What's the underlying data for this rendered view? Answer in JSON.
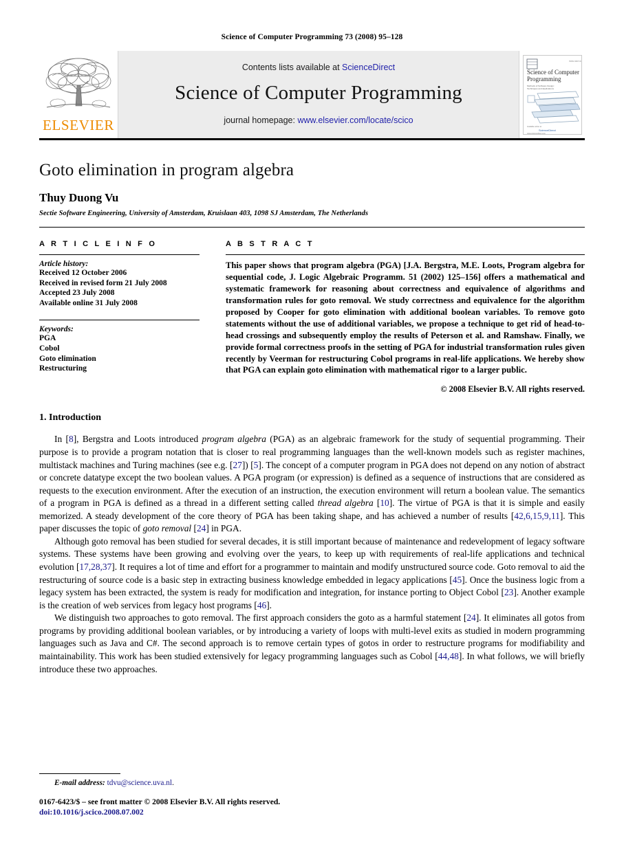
{
  "running_head": "Science of Computer Programming 73 (2008) 95–128",
  "masthead": {
    "publisher_name": "ELSEVIER",
    "publisher_logo_icon": "elsevier-tree-icon",
    "contents_prefix": "Contents lists available at ",
    "contents_link": "ScienceDirect",
    "journal_title": "Science of Computer Programming",
    "homepage_prefix": "journal homepage: ",
    "homepage_link": "www.elsevier.com/locate/scico",
    "cover": {
      "title_line1": "Science of Computer",
      "title_line2": "Programming",
      "subtitle": "Methods of Software Design: Techniques and Applications",
      "corner_label": "ScienceDirect",
      "footer_label": "www.sciencedirect.com"
    }
  },
  "article": {
    "title": "Goto elimination in program algebra",
    "author": "Thuy Duong Vu",
    "affiliation": "Sectie Software Engineering, University of Amsterdam, Kruislaan 403, 1098 SJ Amsterdam, The Netherlands"
  },
  "article_info": {
    "heading": "A R T I C L E   I N F O",
    "history_label": "Article history:",
    "history": [
      "Received 12 October 2006",
      "Received in revised form 21 July 2008",
      "Accepted 23 July 2008",
      "Available online 31 July 2008"
    ],
    "keywords_label": "Keywords:",
    "keywords": [
      "PGA",
      "Cobol",
      "Goto elimination",
      "Restructuring"
    ]
  },
  "abstract": {
    "heading": "A B S T R A C T",
    "text": "This paper shows that program algebra (PGA) [J.A. Bergstra, M.E. Loots, Program algebra for sequential code, J. Logic Algebraic Programm. 51 (2002) 125–156] offers a mathematical and systematic framework for reasoning about correctness and equivalence of algorithms and transformation rules for goto removal. We study correctness and equivalence for the algorithm proposed by Cooper for goto elimination with additional boolean variables. To remove goto statements without the use of additional variables, we propose a technique to get rid of head-to-head crossings and subsequently employ the results of Peterson et al. and Ramshaw. Finally, we provide formal correctness proofs in the setting of PGA for industrial transformation rules given recently by Veerman for restructuring Cobol programs in real-life applications. We hereby show that PGA can explain goto elimination with mathematical rigor to a larger public.",
    "copyright": "© 2008 Elsevier B.V. All rights reserved."
  },
  "body": {
    "section_number_title": "1. Introduction",
    "paragraph1": {
      "p1": "In [",
      "c1": "8",
      "p2": "], Bergstra and Loots introduced ",
      "i1": "program algebra",
      "p3": " (PGA) as an algebraic framework for the study of sequential programming. Their purpose is to provide a program notation that is closer to real programming languages than the well-known models such as register machines, multistack machines and Turing machines (see e.g. [",
      "c2": "27",
      "p4": "]) [",
      "c3": "5",
      "p5": "]. The concept of a computer program in PGA does not depend on any notion of abstract or concrete datatype except the two boolean values. A PGA program (or expression) is defined as a sequence of instructions that are considered as requests to the execution environment. After the execution of an instruction, the execution environment will return a boolean value. The semantics of a program in PGA is defined as a thread in a different setting called ",
      "i2": "thread algebra",
      "p6": " [",
      "c4": "10",
      "p7": "]. The virtue of PGA is that it is simple and easily memorized. A steady development of the core theory of PGA has been taking shape, and has achieved a number of results [",
      "c5": "42,6,15,9,11",
      "p8": "]. This paper discusses the topic of ",
      "i3": "goto removal",
      "p9": " [",
      "c6": "24",
      "p10": "] in PGA."
    },
    "paragraph2": {
      "p1": "Although goto removal has been studied for several decades, it is still important because of maintenance and redevelopment of legacy software systems. These systems have been growing and evolving over the years, to keep up with requirements of real-life applications and technical evolution [",
      "c1": "17,28,37",
      "p2": "]. It requires a lot of time and effort for a programmer to maintain and modify unstructured source code. Goto removal to aid the restructuring of source code is a basic step in extracting business knowledge embedded in legacy applications [",
      "c2": "45",
      "p3": "]. Once the business logic from a legacy system has been extracted, the system is ready for modification and integration, for instance porting to Object Cobol [",
      "c3": "23",
      "p4": "]. Another example is the creation of web services from legacy host programs [",
      "c4": "46",
      "p5": "]."
    },
    "paragraph3": {
      "p1": "We distinguish two approaches to goto removal. The first approach considers the goto as a harmful statement [",
      "c1": "24",
      "p2": "]. It eliminates all gotos from programs by providing additional boolean variables, or by introducing a variety of loops with multi-level exits as studied in modern programming languages such as Java and C#. The second approach is to remove certain types of gotos in order to restructure programs for modifiability and maintainability. This work has been studied extensively for legacy programming languages such as Cobol [",
      "c2": "44,48",
      "p3": "]. In what follows, we will briefly introduce these two approaches."
    }
  },
  "footnote": {
    "email_label": "E-mail address:",
    "email": "tdvu@science.uva.nl",
    "email_suffix": ".",
    "front_matter": "0167-6423/$ – see front matter © 2008 Elsevier B.V. All rights reserved.",
    "doi": "doi:10.1016/j.scico.2008.07.002"
  },
  "colors": {
    "link": "#2222aa",
    "citation": "#1a1a8c",
    "elsevier_orange": "#ED8B00",
    "masthead_bg": "#ececec"
  }
}
